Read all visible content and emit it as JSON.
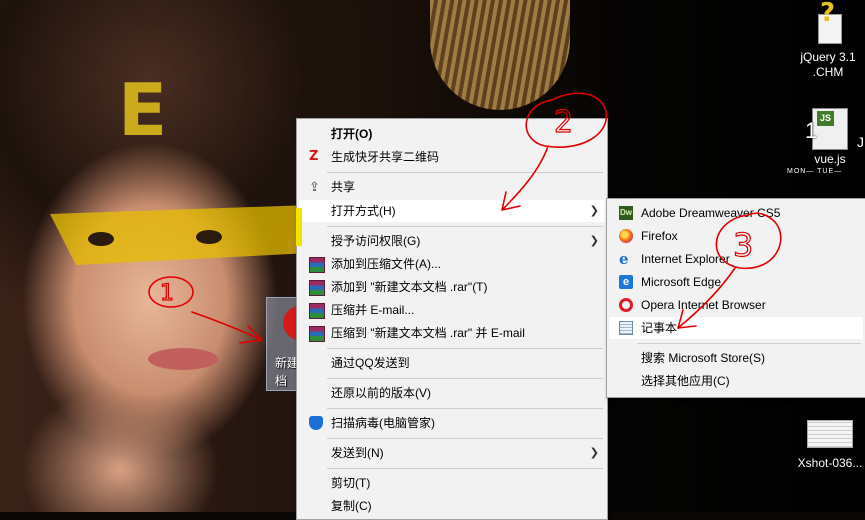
{
  "desktop": {
    "icons": [
      {
        "name": "jquery-chm",
        "label_line1": "jQuery 3.1",
        "label_line2": ".CHM"
      },
      {
        "name": "vue-js",
        "label": "vue.js",
        "overlay": "1",
        "badge": "JS",
        "side_char": "J"
      },
      {
        "name": "xshot",
        "label": "Xshot-036..."
      },
      {
        "name": "new-text-file",
        "label_line1": "新建",
        "label_line2": "档"
      }
    ],
    "calendar_text": "MON—  TUE—"
  },
  "context_menu": {
    "items": [
      {
        "label": "打开(O)",
        "bold": true
      },
      {
        "label": "生成快牙共享二维码",
        "icon": "kuaiya-icon"
      },
      {
        "label": "共享",
        "icon": "share-icon"
      },
      {
        "label": "打开方式(H)",
        "submenu": true
      },
      {
        "label": "授予访问权限(G)",
        "submenu": true
      },
      {
        "label": "添加到压缩文件(A)...",
        "icon": "winrar-icon"
      },
      {
        "label": "添加到 \"新建文本文档 .rar\"(T)",
        "icon": "winrar-icon"
      },
      {
        "label": "压缩并 E-mail...",
        "icon": "winrar-icon"
      },
      {
        "label": "压缩到 \"新建文本文档 .rar\" 并 E-mail",
        "icon": "winrar-icon"
      },
      {
        "label": "通过QQ发送到"
      },
      {
        "label": "还原以前的版本(V)"
      },
      {
        "label": "扫描病毒(电脑管家)",
        "icon": "shield-icon"
      },
      {
        "label": "发送到(N)",
        "submenu": true
      },
      {
        "label": "剪切(T)"
      },
      {
        "label": "复制(C)"
      }
    ],
    "submenu_arrow": "❯"
  },
  "open_with_menu": {
    "items": [
      {
        "label": "Adobe Dreamweaver CS5",
        "icon": "dreamweaver-icon",
        "icon_text": "Dw"
      },
      {
        "label": "Firefox",
        "icon": "firefox-icon"
      },
      {
        "label": "Internet Explorer",
        "icon": "ie-icon",
        "icon_text": "e"
      },
      {
        "label": "Microsoft Edge",
        "icon": "edge-icon",
        "icon_text": "e"
      },
      {
        "label": "Opera Internet Browser",
        "icon": "opera-icon"
      },
      {
        "label": "记事本",
        "icon": "notepad-icon",
        "highlighted": true
      },
      {
        "label": "搜索 Microsoft Store(S)"
      },
      {
        "label": "选择其他应用(C)"
      }
    ]
  },
  "annotations": {
    "circle_labels": [
      "1",
      "2",
      "3"
    ],
    "color": "#e00000"
  },
  "colors": {
    "menu_bg": "#f2f2f2",
    "menu_highlight": "#ffffff",
    "annotation_red": "#e00000",
    "highlight_yellow": "#f2e200"
  }
}
